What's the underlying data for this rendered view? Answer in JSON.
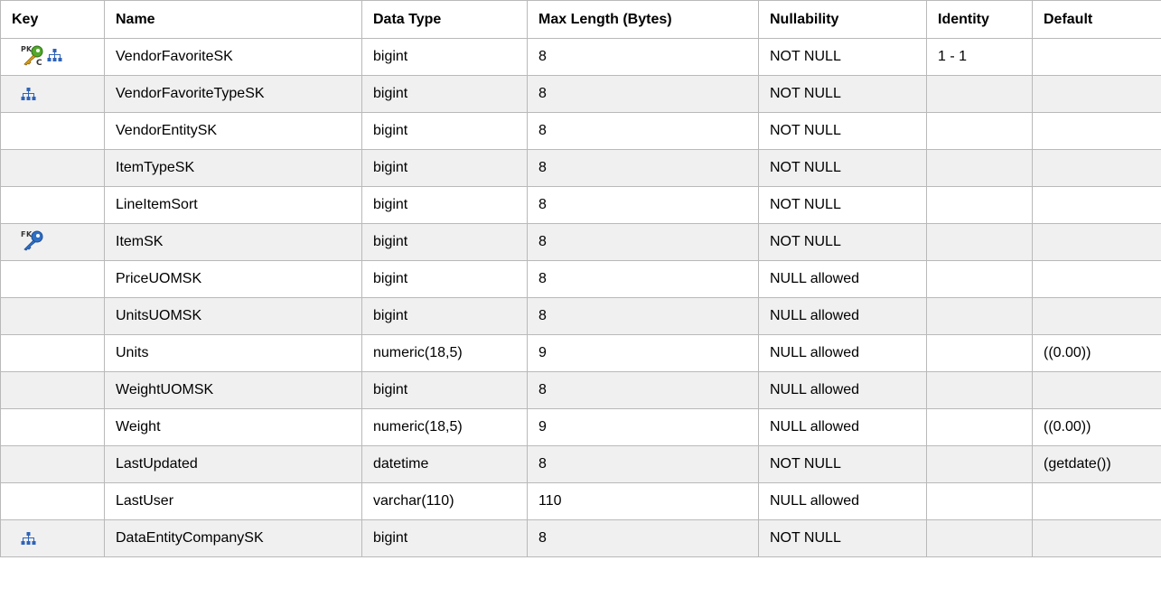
{
  "headers": {
    "key": "Key",
    "name": "Name",
    "data_type": "Data Type",
    "max_length": "Max Length (Bytes)",
    "nullability": "Nullability",
    "identity": "Identity",
    "default": "Default"
  },
  "rows": [
    {
      "keys": [
        "pk-fk-compound-key-icon",
        "hierarchy-icon"
      ],
      "name": "VendorFavoriteSK",
      "data_type": "bigint",
      "max_length": "8",
      "nullability": "NOT NULL",
      "identity": "1 - 1",
      "default": ""
    },
    {
      "keys": [
        "hierarchy-icon"
      ],
      "name": "VendorFavoriteTypeSK",
      "data_type": "bigint",
      "max_length": "8",
      "nullability": "NOT NULL",
      "identity": "",
      "default": ""
    },
    {
      "keys": [],
      "name": "VendorEntitySK",
      "data_type": "bigint",
      "max_length": "8",
      "nullability": "NOT NULL",
      "identity": "",
      "default": ""
    },
    {
      "keys": [],
      "name": "ItemTypeSK",
      "data_type": "bigint",
      "max_length": "8",
      "nullability": "NOT NULL",
      "identity": "",
      "default": ""
    },
    {
      "keys": [],
      "name": "LineItemSort",
      "data_type": "bigint",
      "max_length": "8",
      "nullability": "NOT NULL",
      "identity": "",
      "default": ""
    },
    {
      "keys": [
        "fk-key-icon"
      ],
      "name": "ItemSK",
      "data_type": "bigint",
      "max_length": "8",
      "nullability": "NOT NULL",
      "identity": "",
      "default": ""
    },
    {
      "keys": [],
      "name": "PriceUOMSK",
      "data_type": "bigint",
      "max_length": "8",
      "nullability": "NULL allowed",
      "identity": "",
      "default": ""
    },
    {
      "keys": [],
      "name": "UnitsUOMSK",
      "data_type": "bigint",
      "max_length": "8",
      "nullability": "NULL allowed",
      "identity": "",
      "default": ""
    },
    {
      "keys": [],
      "name": "Units",
      "data_type": "numeric(18,5)",
      "max_length": "9",
      "nullability": "NULL allowed",
      "identity": "",
      "default": "((0.00))"
    },
    {
      "keys": [],
      "name": "WeightUOMSK",
      "data_type": "bigint",
      "max_length": "8",
      "nullability": "NULL allowed",
      "identity": "",
      "default": ""
    },
    {
      "keys": [],
      "name": "Weight",
      "data_type": "numeric(18,5)",
      "max_length": "9",
      "nullability": "NULL allowed",
      "identity": "",
      "default": "((0.00))"
    },
    {
      "keys": [],
      "name": "LastUpdated",
      "data_type": "datetime",
      "max_length": "8",
      "nullability": "NOT NULL",
      "identity": "",
      "default": "(getdate())"
    },
    {
      "keys": [],
      "name": "LastUser",
      "data_type": "varchar(110)",
      "max_length": "110",
      "nullability": "NULL allowed",
      "identity": "",
      "default": ""
    },
    {
      "keys": [
        "hierarchy-icon"
      ],
      "name": "DataEntityCompanySK",
      "data_type": "bigint",
      "max_length": "8",
      "nullability": "NOT NULL",
      "identity": "",
      "default": ""
    }
  ],
  "colors": {
    "border": "#b9b9b9",
    "alt_row": "#f0f0f0",
    "hierarchy_icon": "#2f63b8",
    "pk_key_green": "#52a82a",
    "fk_key_blue": "#2f6fc4"
  }
}
